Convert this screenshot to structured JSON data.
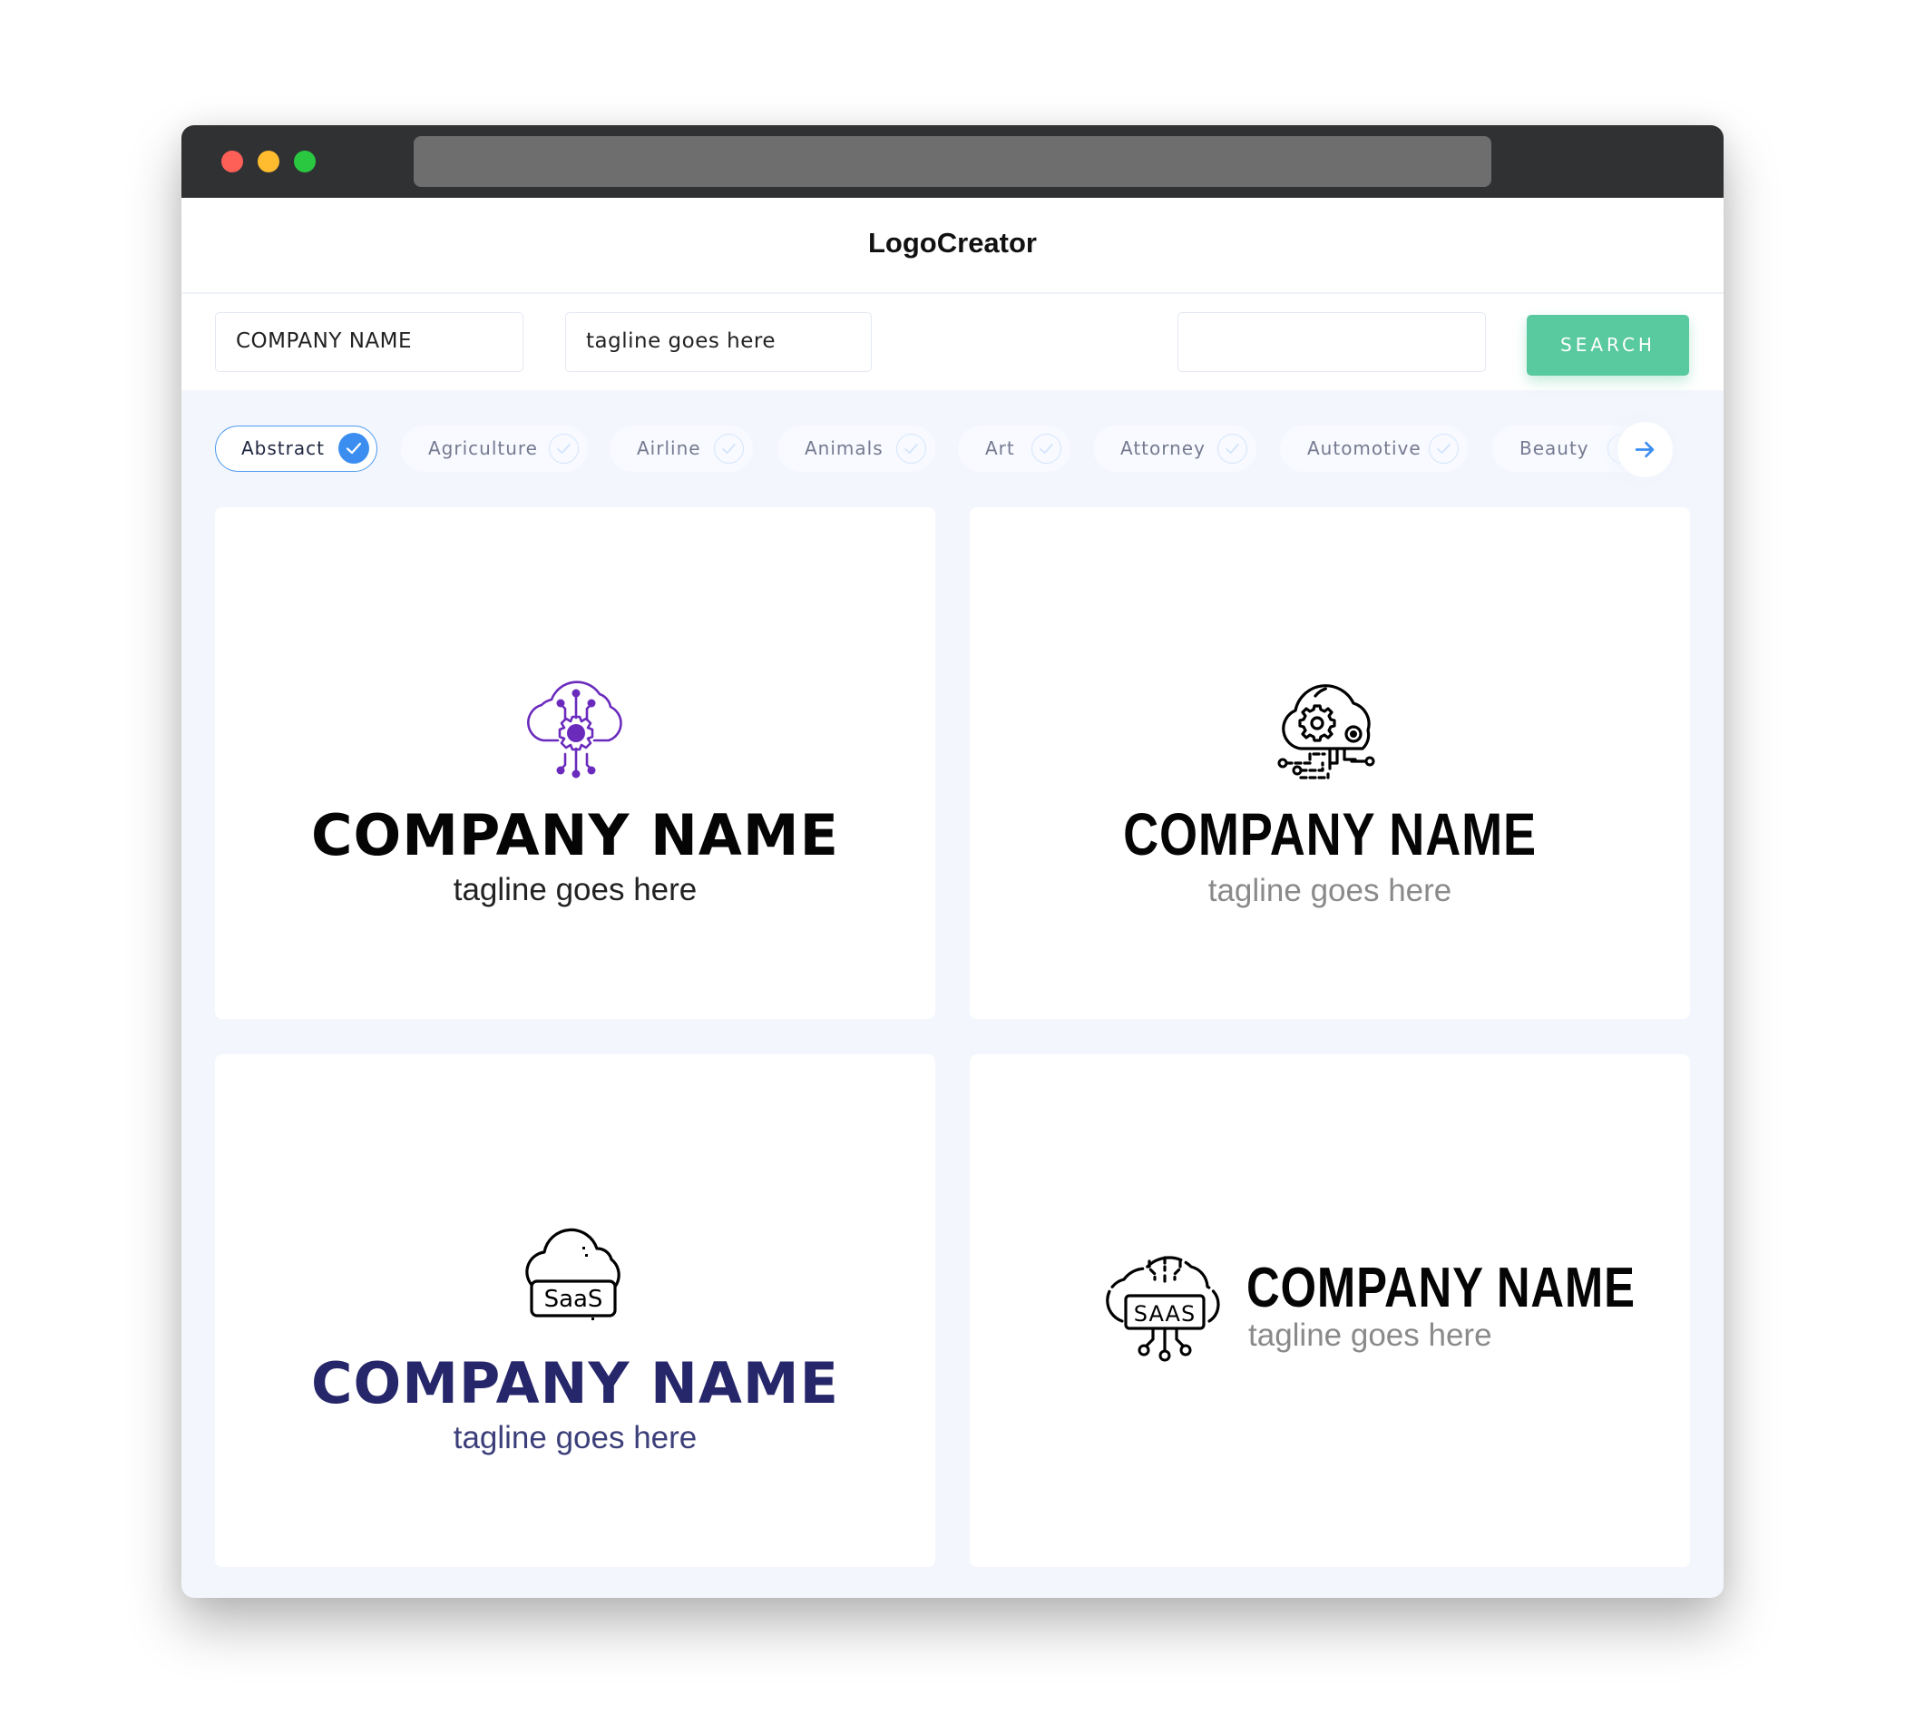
{
  "window": {
    "controls": [
      "close",
      "minimize",
      "maximize"
    ],
    "address_bar": ""
  },
  "header": {
    "title": "LogoCreator"
  },
  "search": {
    "company_name_value": "COMPANY NAME",
    "tagline_value": "tagline goes here",
    "keyword_value": "",
    "search_label": "SEARCH"
  },
  "categories": {
    "items": [
      {
        "label": "Abstract",
        "selected": true
      },
      {
        "label": "Agriculture",
        "selected": false
      },
      {
        "label": "Airline",
        "selected": false
      },
      {
        "label": "Animals",
        "selected": false
      },
      {
        "label": "Art",
        "selected": false
      },
      {
        "label": "Attorney",
        "selected": false
      },
      {
        "label": "Automotive",
        "selected": false
      },
      {
        "label": "Beauty",
        "selected": false
      }
    ],
    "next_icon": "arrow-right-icon"
  },
  "logos": [
    {
      "icon": "cloud-circuit-gear-icon",
      "company_name": "COMPANY NAME",
      "tagline": "tagline goes here",
      "icon_color": "#6a2bbd",
      "name_color": "#050505",
      "layout": "stacked"
    },
    {
      "icon": "cloud-gears-circuit-icon",
      "company_name": "COMPANY NAME",
      "tagline": "tagline goes here",
      "icon_color": "#000000",
      "name_color": "#050505",
      "layout": "stacked"
    },
    {
      "icon": "cloud-saas-icon",
      "icon_text": "SaaS",
      "company_name": "COMPANY NAME",
      "tagline": "tagline goes here",
      "icon_color": "#000000",
      "name_color": "#26266a",
      "layout": "stacked"
    },
    {
      "icon": "cloud-saas-circuit-icon",
      "icon_text": "SAAS",
      "company_name": "COMPANY NAME",
      "tagline": "tagline goes here",
      "icon_color": "#000000",
      "name_color": "#050505",
      "layout": "inline"
    }
  ],
  "colors": {
    "accent_green": "#59c99f",
    "accent_blue": "#3b8ef0",
    "chrome": "#303133",
    "page_bg": "#f3f6fc"
  }
}
